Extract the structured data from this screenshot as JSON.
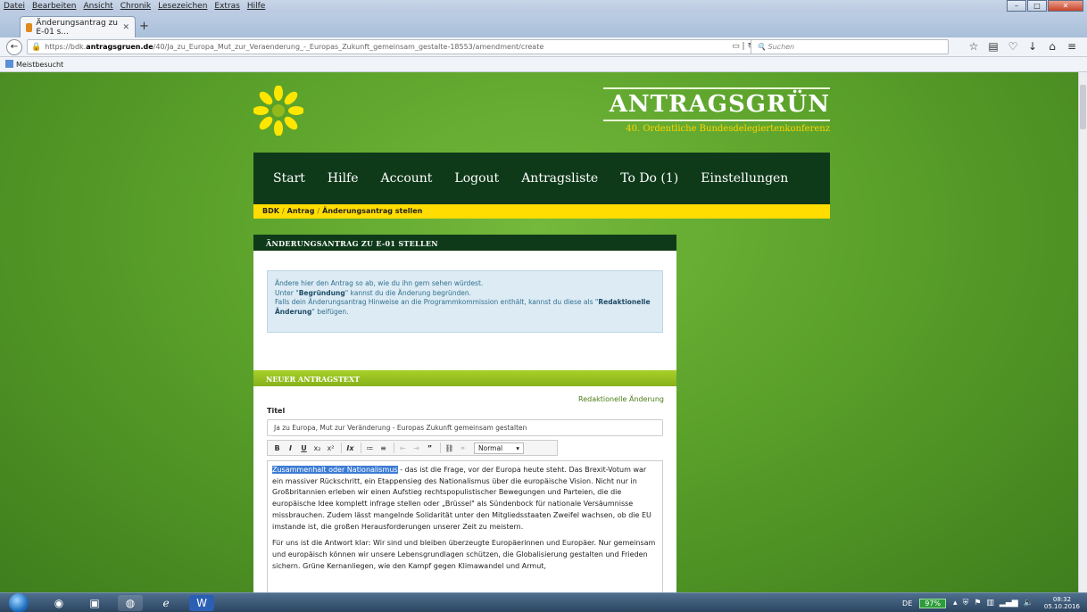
{
  "browser": {
    "menu": [
      "Datei",
      "Bearbeiten",
      "Ansicht",
      "Chronik",
      "Lesezeichen",
      "Extras",
      "Hilfe"
    ],
    "tab_title": "Änderungsantrag zu E-01 s...",
    "url_prefix": "https://bdk.",
    "url_host": "antragsgruen.de",
    "url_path": "/40/Ja_zu_Europa_Mut_zur_Veraenderung_-_Europas_Zukunft_gemeinsam_gestalte-18553/amendment/create",
    "search_placeholder": "Suchen",
    "bookmark": "Meistbesucht"
  },
  "site": {
    "brand_title": "ANTRAGSGRÜN",
    "brand_subtitle": "40. Ordentliche Bundesdelegiertenkonferenz",
    "nav": [
      "Start",
      "Hilfe",
      "Account",
      "Logout",
      "Antragsliste",
      "To Do (1)",
      "Einstellungen"
    ],
    "breadcrumb": [
      "BDK",
      "Antrag",
      "Änderungsantrag stellen"
    ]
  },
  "form": {
    "panel_title": "ÄNDERUNGSANTRAG ZU E-01 STELLEN",
    "info_line1": "Ändere hier den Antrag so ab, wie du ihn gern sehen würdest.",
    "info_line2_a": "Unter \"",
    "info_line2_b": "Begründung",
    "info_line2_c": "\" kannst du die Änderung begründen.",
    "info_line3_a": "Falls dein Änderungsantrag Hinweise an die Programmkommission enthält, kannst du diese als \"",
    "info_line3_b": "Redaktionelle Änderung",
    "info_line3_c": "\" beifügen.",
    "section_title": "NEUER ANTRAGSTEXT",
    "redaktionell_link": "Redaktionelle Änderung",
    "title_label": "Titel",
    "title_value": "Ja zu Europa, Mut zur Veränderung - Europas Zukunft gemeinsam gestalten",
    "format_select": "Normal",
    "para1_highlight": "Zusammenhalt oder Nationalismus",
    "para1_rest": " - das ist die Frage, vor der Europa heute steht. Das Brexit-Votum war ein massiver Rückschritt, ein Etappensieg des Nationalismus über die europäische Vision. Nicht nur in Großbritannien erleben wir einen Aufstieg rechtspopulistischer Bewegungen und Parteien, die die europäische Idee komplett infrage stellen oder „Brüssel\" als Sündenbock für nationale Versäumnisse missbrauchen. Zudem lässt mangelnde Solidarität unter den Mitgliedsstaaten Zweifel wachsen, ob die EU imstande ist, die großen Herausforderungen unserer Zeit zu meistern.",
    "para2": "Für uns ist die Antwort klar: Wir sind und bleiben überzeugte Europäerinnen und Europäer. Nur gemeinsam und europäisch können wir unsere Lebensgrundlagen schützen, die Globalisierung gestalten und Frieden sichern. Grüne Kernanliegen, wie den Kampf gegen Klimawandel und Armut,"
  },
  "taskbar": {
    "lang": "DE",
    "battery": "97%",
    "time": "08:32",
    "date": "05.10.2016"
  },
  "colors": {
    "page_green": "#5aa12a",
    "nav_dark_green": "#0f3a1a",
    "breadcrumb_yellow": "#ffdd00",
    "section_lime": "#9ac422",
    "info_blue": "#dcebf4"
  }
}
